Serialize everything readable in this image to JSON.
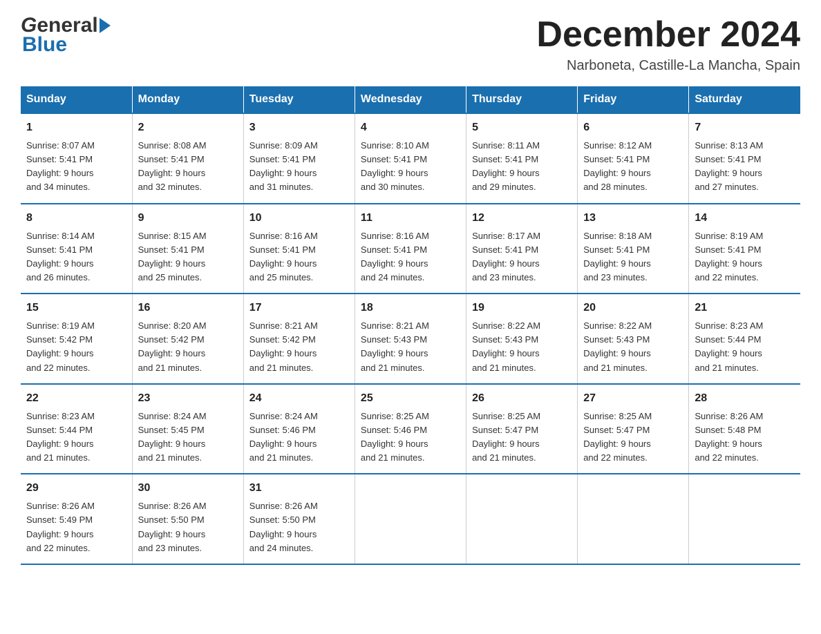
{
  "header": {
    "logo_general": "General",
    "logo_blue": "Blue",
    "month_title": "December 2024",
    "location": "Narboneta, Castille-La Mancha, Spain"
  },
  "days_of_week": [
    "Sunday",
    "Monday",
    "Tuesday",
    "Wednesday",
    "Thursday",
    "Friday",
    "Saturday"
  ],
  "weeks": [
    [
      {
        "day": "1",
        "sunrise": "8:07 AM",
        "sunset": "5:41 PM",
        "daylight": "9 hours and 34 minutes."
      },
      {
        "day": "2",
        "sunrise": "8:08 AM",
        "sunset": "5:41 PM",
        "daylight": "9 hours and 32 minutes."
      },
      {
        "day": "3",
        "sunrise": "8:09 AM",
        "sunset": "5:41 PM",
        "daylight": "9 hours and 31 minutes."
      },
      {
        "day": "4",
        "sunrise": "8:10 AM",
        "sunset": "5:41 PM",
        "daylight": "9 hours and 30 minutes."
      },
      {
        "day": "5",
        "sunrise": "8:11 AM",
        "sunset": "5:41 PM",
        "daylight": "9 hours and 29 minutes."
      },
      {
        "day": "6",
        "sunrise": "8:12 AM",
        "sunset": "5:41 PM",
        "daylight": "9 hours and 28 minutes."
      },
      {
        "day": "7",
        "sunrise": "8:13 AM",
        "sunset": "5:41 PM",
        "daylight": "9 hours and 27 minutes."
      }
    ],
    [
      {
        "day": "8",
        "sunrise": "8:14 AM",
        "sunset": "5:41 PM",
        "daylight": "9 hours and 26 minutes."
      },
      {
        "day": "9",
        "sunrise": "8:15 AM",
        "sunset": "5:41 PM",
        "daylight": "9 hours and 25 minutes."
      },
      {
        "day": "10",
        "sunrise": "8:16 AM",
        "sunset": "5:41 PM",
        "daylight": "9 hours and 25 minutes."
      },
      {
        "day": "11",
        "sunrise": "8:16 AM",
        "sunset": "5:41 PM",
        "daylight": "9 hours and 24 minutes."
      },
      {
        "day": "12",
        "sunrise": "8:17 AM",
        "sunset": "5:41 PM",
        "daylight": "9 hours and 23 minutes."
      },
      {
        "day": "13",
        "sunrise": "8:18 AM",
        "sunset": "5:41 PM",
        "daylight": "9 hours and 23 minutes."
      },
      {
        "day": "14",
        "sunrise": "8:19 AM",
        "sunset": "5:41 PM",
        "daylight": "9 hours and 22 minutes."
      }
    ],
    [
      {
        "day": "15",
        "sunrise": "8:19 AM",
        "sunset": "5:42 PM",
        "daylight": "9 hours and 22 minutes."
      },
      {
        "day": "16",
        "sunrise": "8:20 AM",
        "sunset": "5:42 PM",
        "daylight": "9 hours and 21 minutes."
      },
      {
        "day": "17",
        "sunrise": "8:21 AM",
        "sunset": "5:42 PM",
        "daylight": "9 hours and 21 minutes."
      },
      {
        "day": "18",
        "sunrise": "8:21 AM",
        "sunset": "5:43 PM",
        "daylight": "9 hours and 21 minutes."
      },
      {
        "day": "19",
        "sunrise": "8:22 AM",
        "sunset": "5:43 PM",
        "daylight": "9 hours and 21 minutes."
      },
      {
        "day": "20",
        "sunrise": "8:22 AM",
        "sunset": "5:43 PM",
        "daylight": "9 hours and 21 minutes."
      },
      {
        "day": "21",
        "sunrise": "8:23 AM",
        "sunset": "5:44 PM",
        "daylight": "9 hours and 21 minutes."
      }
    ],
    [
      {
        "day": "22",
        "sunrise": "8:23 AM",
        "sunset": "5:44 PM",
        "daylight": "9 hours and 21 minutes."
      },
      {
        "day": "23",
        "sunrise": "8:24 AM",
        "sunset": "5:45 PM",
        "daylight": "9 hours and 21 minutes."
      },
      {
        "day": "24",
        "sunrise": "8:24 AM",
        "sunset": "5:46 PM",
        "daylight": "9 hours and 21 minutes."
      },
      {
        "day": "25",
        "sunrise": "8:25 AM",
        "sunset": "5:46 PM",
        "daylight": "9 hours and 21 minutes."
      },
      {
        "day": "26",
        "sunrise": "8:25 AM",
        "sunset": "5:47 PM",
        "daylight": "9 hours and 21 minutes."
      },
      {
        "day": "27",
        "sunrise": "8:25 AM",
        "sunset": "5:47 PM",
        "daylight": "9 hours and 22 minutes."
      },
      {
        "day": "28",
        "sunrise": "8:26 AM",
        "sunset": "5:48 PM",
        "daylight": "9 hours and 22 minutes."
      }
    ],
    [
      {
        "day": "29",
        "sunrise": "8:26 AM",
        "sunset": "5:49 PM",
        "daylight": "9 hours and 22 minutes."
      },
      {
        "day": "30",
        "sunrise": "8:26 AM",
        "sunset": "5:50 PM",
        "daylight": "9 hours and 23 minutes."
      },
      {
        "day": "31",
        "sunrise": "8:26 AM",
        "sunset": "5:50 PM",
        "daylight": "9 hours and 24 minutes."
      },
      null,
      null,
      null,
      null
    ]
  ],
  "labels": {
    "sunrise": "Sunrise:",
    "sunset": "Sunset:",
    "daylight": "Daylight:"
  }
}
